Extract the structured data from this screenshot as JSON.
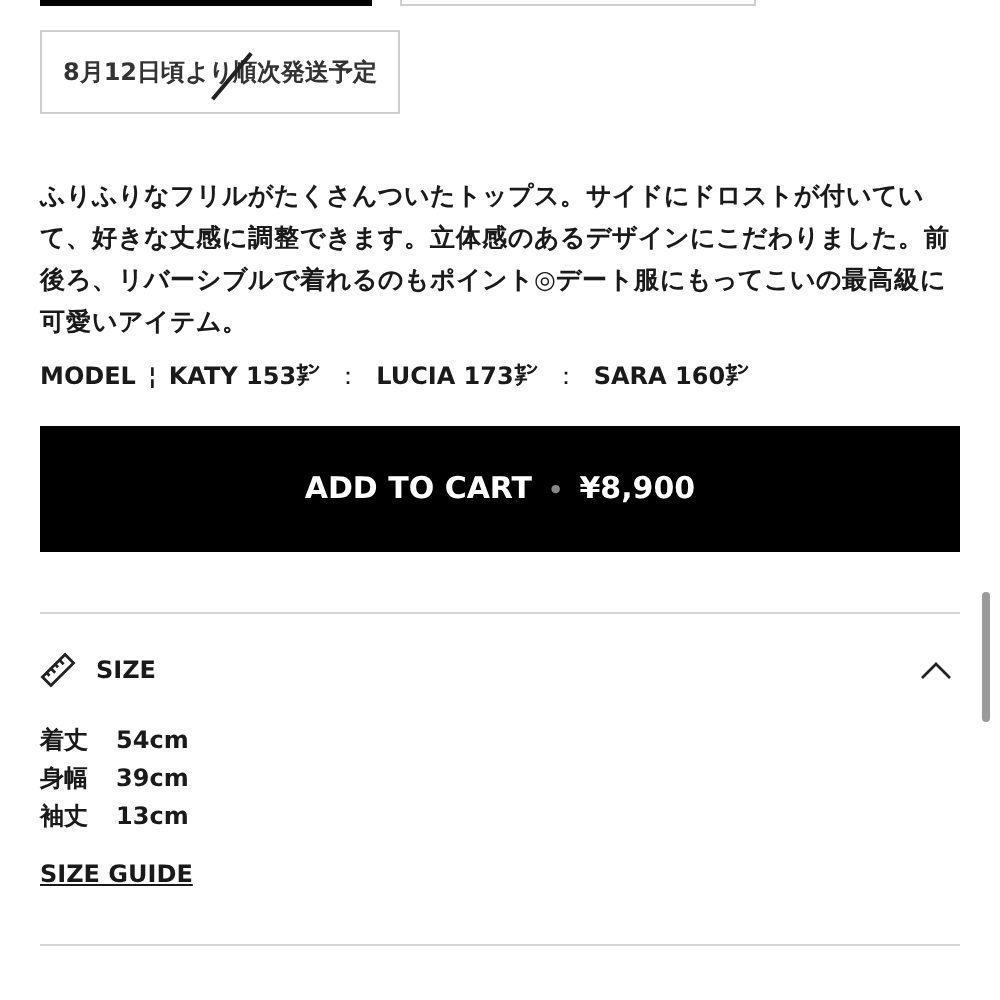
{
  "top_buttons": [
    {
      "kind": "filled"
    },
    {
      "kind": "outlined"
    }
  ],
  "delivery_badge": {
    "text": "8月12日頃より順次発送予定",
    "struck": true
  },
  "description": "ふりふりなフリルがたくさんついたトップス。サイドにドロストが付いていて、好きな丈感に調整できます。立体感のあるデザインにこだわりました。前後ろ、リバーシブルで着れるのもポイント◎デート服にもってこいの最高級に可愛いアイテム。",
  "model_line": {
    "label": "MODEL",
    "separator": "¦",
    "models": [
      {
        "name": "KATY 153㌢"
      },
      {
        "name": "LUCIA 173㌢"
      },
      {
        "name": "SARA 160㌢"
      }
    ],
    "divider": "："
  },
  "cart_button": {
    "label": "ADD TO CART",
    "separator": "•",
    "price": "¥8,900"
  },
  "size_section": {
    "title": "SIZE",
    "expanded": true,
    "rows": [
      {
        "label": "着丈",
        "value": "54cm"
      },
      {
        "label": "身幅",
        "value": "39cm"
      },
      {
        "label": "袖丈",
        "value": "13cm"
      }
    ],
    "guide_link": "SIZE GUIDE"
  }
}
